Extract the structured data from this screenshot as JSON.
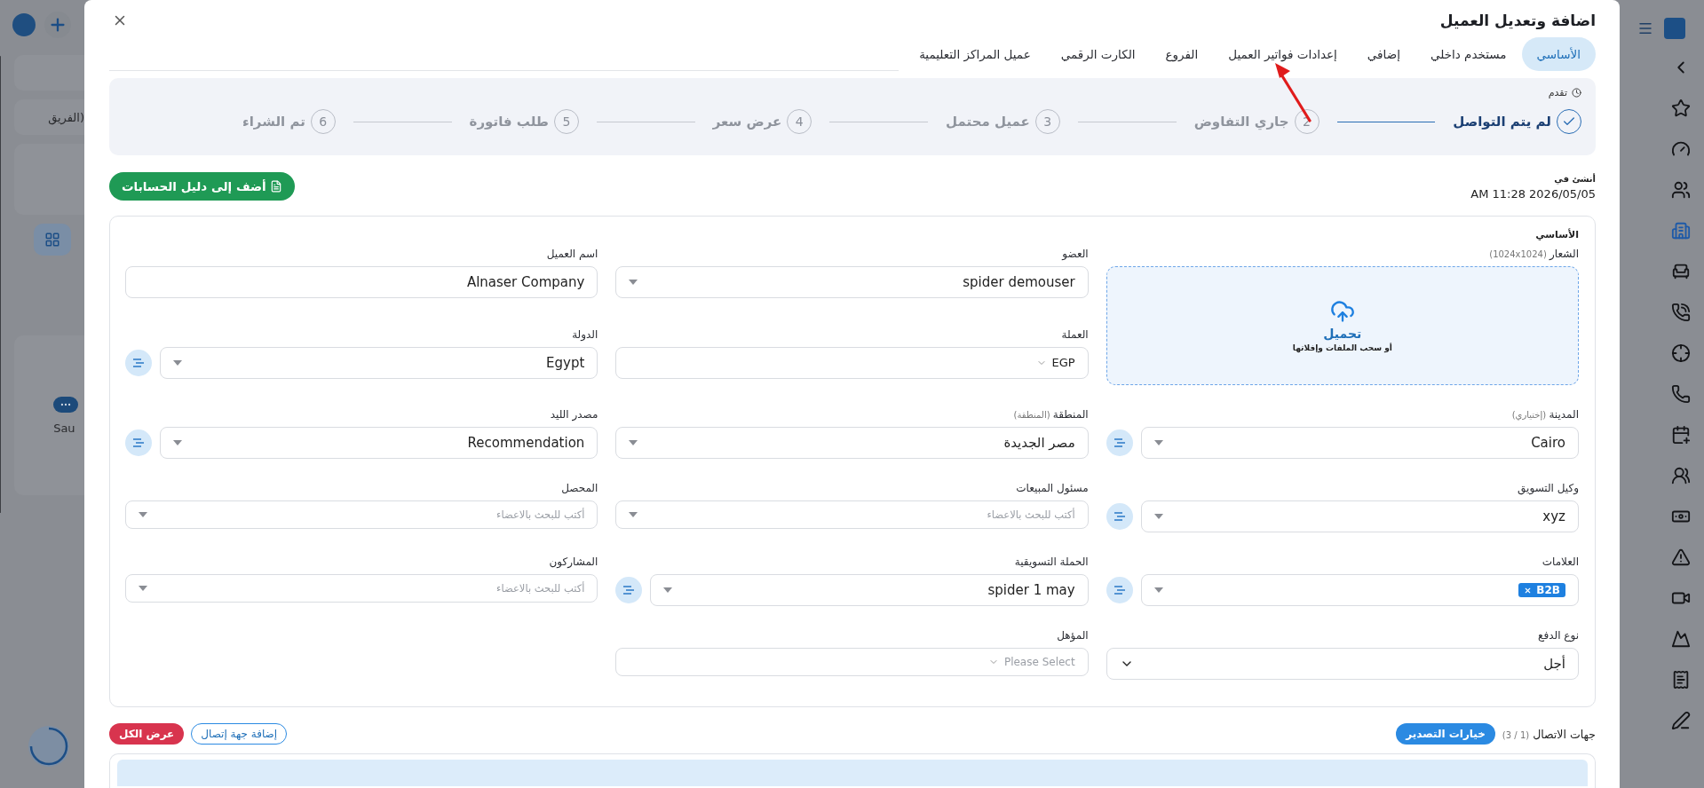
{
  "background": {
    "filter_text": "الفريق)",
    "card_text": "Sau"
  },
  "modal": {
    "title": "اضافة وتعديل العميل"
  },
  "tabs": [
    {
      "label": "الأساسي",
      "selected": true
    },
    {
      "label": "مستخدم داخلي",
      "selected": false
    },
    {
      "label": "إضافي",
      "selected": false
    },
    {
      "label": "إعدادات فواتير العميل",
      "selected": false
    },
    {
      "label": "الفروع",
      "selected": false
    },
    {
      "label": "الكارت الرقمي",
      "selected": false
    },
    {
      "label": "عميل المراكز التعليمية",
      "selected": false
    }
  ],
  "progress": {
    "title": "تقدم",
    "steps": [
      {
        "label": "لم يتم التواصل",
        "done": true
      },
      {
        "number": "2",
        "label": "جاري التفاوض",
        "done": false
      },
      {
        "number": "3",
        "label": "عميل محتمل",
        "done": false
      },
      {
        "number": "4",
        "label": "عرض سعر",
        "done": false
      },
      {
        "number": "5",
        "label": "طلب فاتورة",
        "done": false
      },
      {
        "number": "6",
        "label": "تم الشراء",
        "done": false
      }
    ]
  },
  "created": {
    "label": "أنشئ في",
    "value": "AM 11:28 2026/05/05"
  },
  "add_account_button": "أضف إلى دليل الحسابات",
  "basic": {
    "title": "الأساسي",
    "fields": [
      {
        "kind": "upload",
        "label": "الشعار",
        "note": "(1024x1024)",
        "action": "تحميل",
        "hint": "أو سحب الملفات وإفلاتها"
      },
      {
        "kind": "select",
        "label": "العضو",
        "value": "spider demouser",
        "side_button": false
      },
      {
        "kind": "text",
        "label": "اسم العميل",
        "value": "Alnaser Company",
        "side_button": false
      },
      {
        "kind": "compact",
        "label": "العملة",
        "value": "EGP",
        "side_button": false
      },
      {
        "kind": "select",
        "label": "الدولة",
        "value": "Egypt",
        "side_button": true
      },
      {
        "kind": "select",
        "label": "المدينة",
        "note": "(إختياري)",
        "value": "Cairo",
        "side_button": true
      },
      {
        "kind": "select",
        "label": "المنطقة",
        "note": "(المنطقة)",
        "value": "مصر الجديدة",
        "side_button": false
      },
      {
        "kind": "select",
        "label": "مصدر الليد",
        "value": "Recommendation",
        "side_button": true
      },
      {
        "kind": "select",
        "label": "وكيل التسويق",
        "value": "xyz",
        "side_button": true
      },
      {
        "kind": "select",
        "label": "مسئول المبيعات",
        "placeholder": "أكتب للبحث بالاعضاء",
        "side_button": false
      },
      {
        "kind": "select",
        "label": "المحصل",
        "placeholder": "أكتب للبحث بالاعضاء",
        "side_button": false
      },
      {
        "kind": "select",
        "label": "العلامات",
        "tags": [
          "B2B"
        ],
        "side_button": true
      },
      {
        "kind": "select",
        "label": "الحملة التسويقية",
        "value": "spider 1 may",
        "side_button": true
      },
      {
        "kind": "select",
        "label": "المشاركون",
        "placeholder": "أكتب للبحث بالاعضاء",
        "side_button": false
      },
      {
        "kind": "dropdown",
        "label": "نوع الدفع",
        "value": "أجل",
        "side_button": false
      },
      {
        "kind": "compact",
        "label": "المؤهل",
        "placeholder": "Please Select",
        "side_button": false
      }
    ]
  },
  "contacts": {
    "title": "جهات الاتصال",
    "count": "(1 / 3)",
    "export_button": "خيارات التصدير",
    "add_button": "إضافة جهة إتصال",
    "view_all_button": "عرض الكل"
  }
}
